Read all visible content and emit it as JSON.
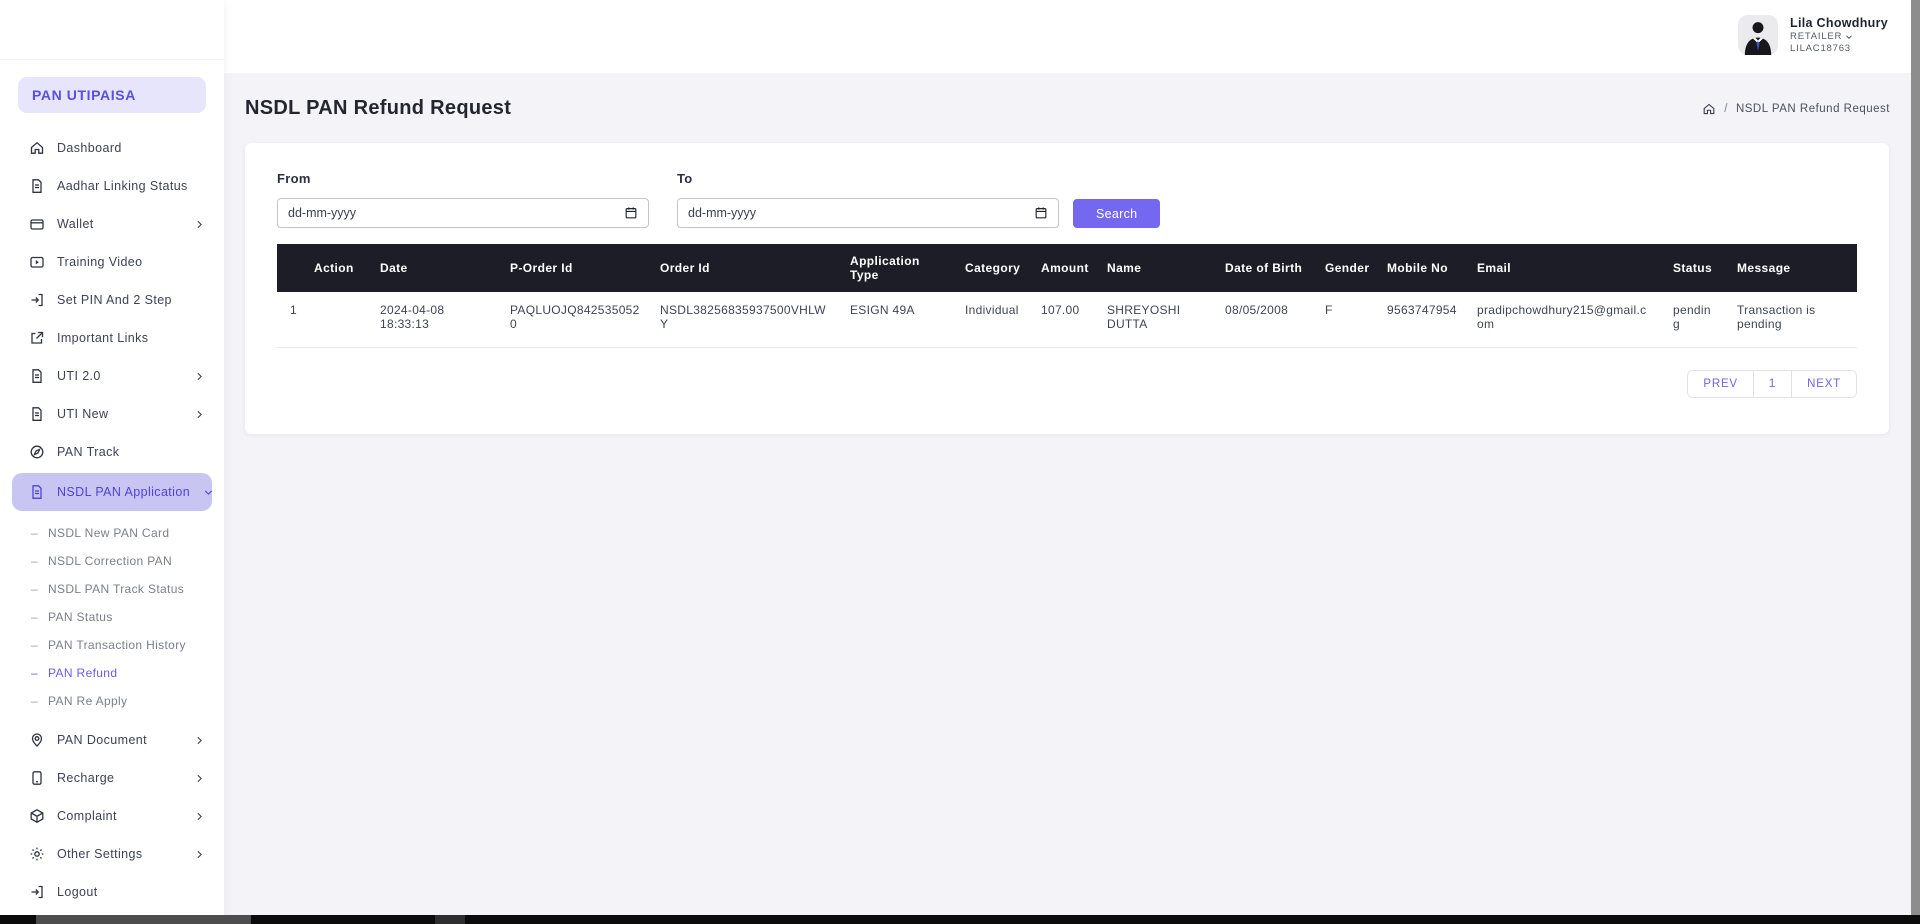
{
  "brand": "PAN UTIPAISA",
  "user": {
    "name": "Lila Chowdhury",
    "role": "RETAILER",
    "code": "LILAC18763"
  },
  "page": {
    "title": "NSDL PAN Refund Request",
    "breadcrumb_sep": "/",
    "breadcrumb_current": "NSDL PAN Refund Request"
  },
  "filter": {
    "from_label": "From",
    "to_label": "To",
    "date_placeholder": "dd-mm-yyyy",
    "search_label": "Search"
  },
  "sidebar": {
    "items": [
      {
        "label": "Dashboard",
        "icon": "home-icon"
      },
      {
        "label": "Aadhar Linking Status",
        "icon": "document-icon"
      },
      {
        "label": "Wallet",
        "icon": "wallet-icon",
        "expandable": true
      },
      {
        "label": "Training Video",
        "icon": "video-icon"
      },
      {
        "label": "Set PIN And 2 Step",
        "icon": "login-arrow-icon"
      },
      {
        "label": "Important Links",
        "icon": "external-link-icon"
      },
      {
        "label": "UTI 2.0",
        "icon": "document-icon",
        "expandable": true
      },
      {
        "label": "UTI New",
        "icon": "document-icon",
        "expandable": true
      },
      {
        "label": "PAN Track",
        "icon": "compass-icon"
      },
      {
        "label": "NSDL PAN Application",
        "icon": "document-icon",
        "expandable": true,
        "expanded": true,
        "active": true
      },
      {
        "label": "PAN Document",
        "icon": "map-pin-icon",
        "expandable": true
      },
      {
        "label": "Recharge",
        "icon": "smartphone-icon",
        "expandable": true
      },
      {
        "label": "Complaint",
        "icon": "cube-icon",
        "expandable": true
      },
      {
        "label": "Other Settings",
        "icon": "gear-icon",
        "expandable": true
      },
      {
        "label": "Logout",
        "icon": "logout-icon"
      }
    ],
    "submenu": [
      {
        "label": "NSDL New PAN Card"
      },
      {
        "label": "NSDL Correction PAN"
      },
      {
        "label": "NSDL PAN Track Status"
      },
      {
        "label": "PAN Status"
      },
      {
        "label": "PAN Transaction History"
      },
      {
        "label": "PAN Refund",
        "active": true
      },
      {
        "label": "PAN Re Apply"
      }
    ]
  },
  "table": {
    "columns": [
      "Action",
      "Date",
      "P-Order Id",
      "Order Id",
      "Application Type",
      "Category",
      "Amount",
      "Name",
      "Date of Birth",
      "Gender",
      "Mobile No",
      "Email",
      "Status",
      "Message"
    ],
    "rows": [
      [
        "1",
        "2024-04-08 18:33:13",
        "PAQLUOJQ8425350520",
        "NSDL38256835937500VHLWY",
        "ESIGN 49A",
        "Individual",
        "107.00",
        "SHREYOSHI DUTTA",
        "08/05/2008",
        "F",
        "9563747954",
        "pradipchowdhury215@gmail.com",
        "pending",
        "Transaction is pending"
      ]
    ]
  },
  "pagination": {
    "prev": "PREV",
    "page": "1",
    "next": "NEXT"
  },
  "colors": {
    "accent": "#6e63ee",
    "brand_bg": "#e7e5fb",
    "active_item_bg": "#c9c5f3",
    "active_item_text": "#4f43d8",
    "button_bg": "#7468f1",
    "table_header_bg": "#1d1d28",
    "main_bg": "#f4f4f8",
    "tie_blue": "#2f58cc"
  }
}
